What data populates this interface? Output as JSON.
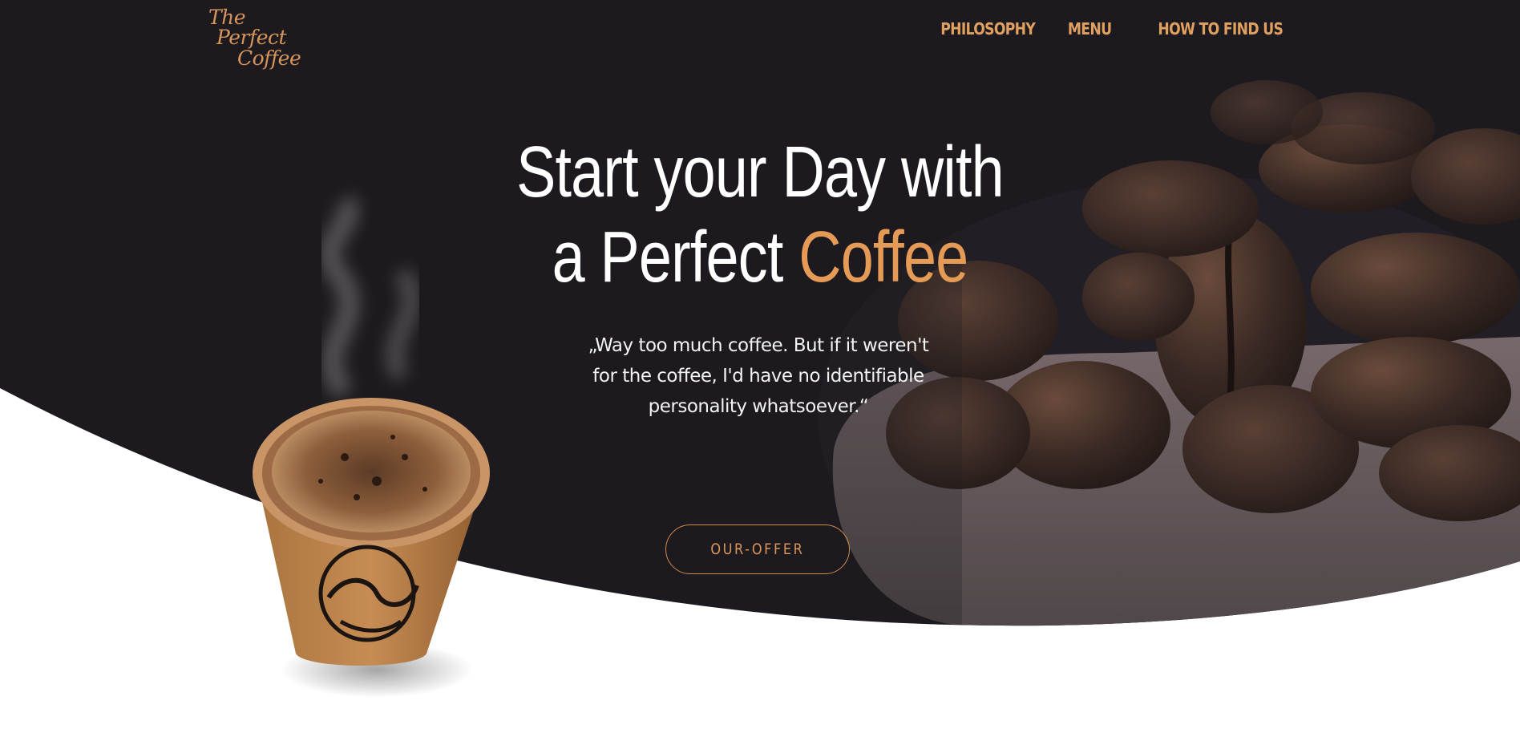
{
  "brand": {
    "logo_lines": [
      "The",
      "Perfect",
      "Coffee"
    ],
    "accent_color": "#e59a55",
    "background_color": "#1d1a1f"
  },
  "nav": {
    "items": [
      "PHILOSOPHY",
      "MENU",
      "HOW TO FIND US"
    ]
  },
  "hero": {
    "headline_line1": "Start your Day with",
    "headline_line2_prefix": "a Perfect ",
    "headline_line2_accent": "Coffee",
    "quote_lines": [
      "„Way too much coffee. But if it weren't",
      "for the coffee, I'd have no identifiable",
      "personality whatsoever.“"
    ],
    "cta_label": "OUR-OFFER"
  },
  "images": {
    "coffee_beans_photo": "coffee-beans-on-spoon",
    "coffee_cup_photo": "paper-coffee-cup-with-steam"
  }
}
